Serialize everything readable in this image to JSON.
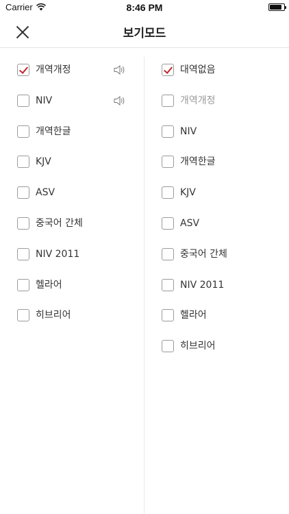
{
  "status": {
    "carrier": "Carrier",
    "time": "8:46 PM"
  },
  "header": {
    "title": "보기모드"
  },
  "left_column": [
    {
      "label": "개역개정",
      "checked": true,
      "speaker": true
    },
    {
      "label": "NIV",
      "checked": false,
      "speaker": true
    },
    {
      "label": "개역한글",
      "checked": false,
      "speaker": false
    },
    {
      "label": "KJV",
      "checked": false,
      "speaker": false
    },
    {
      "label": "ASV",
      "checked": false,
      "speaker": false
    },
    {
      "label": "중국어 간체",
      "checked": false,
      "speaker": false
    },
    {
      "label": "NIV 2011",
      "checked": false,
      "speaker": false
    },
    {
      "label": "헬라어",
      "checked": false,
      "speaker": false
    },
    {
      "label": "히브리어",
      "checked": false,
      "speaker": false
    }
  ],
  "right_column": [
    {
      "label": "대역없음",
      "checked": true,
      "disabled": false
    },
    {
      "label": "개역개정",
      "checked": false,
      "disabled": true
    },
    {
      "label": "NIV",
      "checked": false,
      "disabled": false
    },
    {
      "label": "개역한글",
      "checked": false,
      "disabled": false
    },
    {
      "label": "KJV",
      "checked": false,
      "disabled": false
    },
    {
      "label": "ASV",
      "checked": false,
      "disabled": false
    },
    {
      "label": "중국어 간체",
      "checked": false,
      "disabled": false
    },
    {
      "label": "NIV 2011",
      "checked": false,
      "disabled": false
    },
    {
      "label": "헬라어",
      "checked": false,
      "disabled": false
    },
    {
      "label": "히브리어",
      "checked": false,
      "disabled": false
    }
  ],
  "colors": {
    "check_accent": "#c0262d",
    "disabled_text": "#9a9a9a",
    "divider": "#e8e8e8"
  },
  "icons": {
    "close": "close-icon",
    "speaker": "speaker-icon",
    "wifi": "wifi-icon",
    "battery": "battery-icon"
  }
}
